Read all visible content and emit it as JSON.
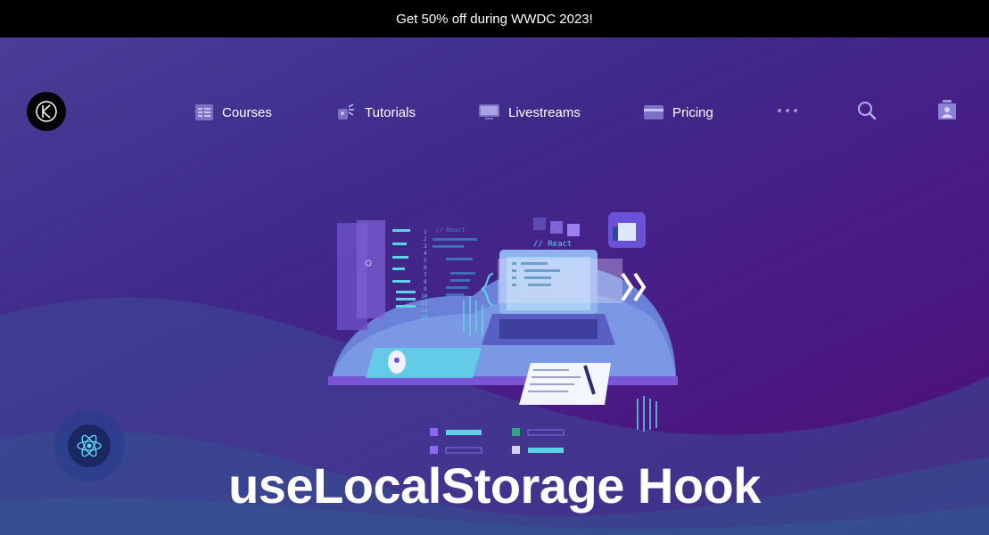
{
  "banner": {
    "text": "Get 50% off during WWDC 2023!"
  },
  "nav": {
    "courses": "Courses",
    "tutorials": "Tutorials",
    "livestreams": "Livestreams",
    "pricing": "Pricing"
  },
  "hero": {
    "title": "useLocalStorage Hook",
    "illustration": {
      "code_comment_left": "// React",
      "code_comment_right": "// React",
      "line_numbers": [
        "1",
        "2",
        "3",
        "4",
        "5",
        "6",
        "7",
        "8",
        "9",
        "10",
        "11",
        "12",
        "13"
      ]
    }
  },
  "colors": {
    "banner_bg": "#000000",
    "hero_top": "#4a3d98",
    "hero_bottom": "#4c0f70",
    "accent_cyan": "#5fd3e6",
    "accent_purple": "#8a6bf0"
  },
  "icons": [
    "logo-icon",
    "courses-icon",
    "tutorials-icon",
    "livestreams-icon",
    "pricing-icon",
    "more-icon",
    "search-icon",
    "account-icon",
    "react-icon"
  ]
}
